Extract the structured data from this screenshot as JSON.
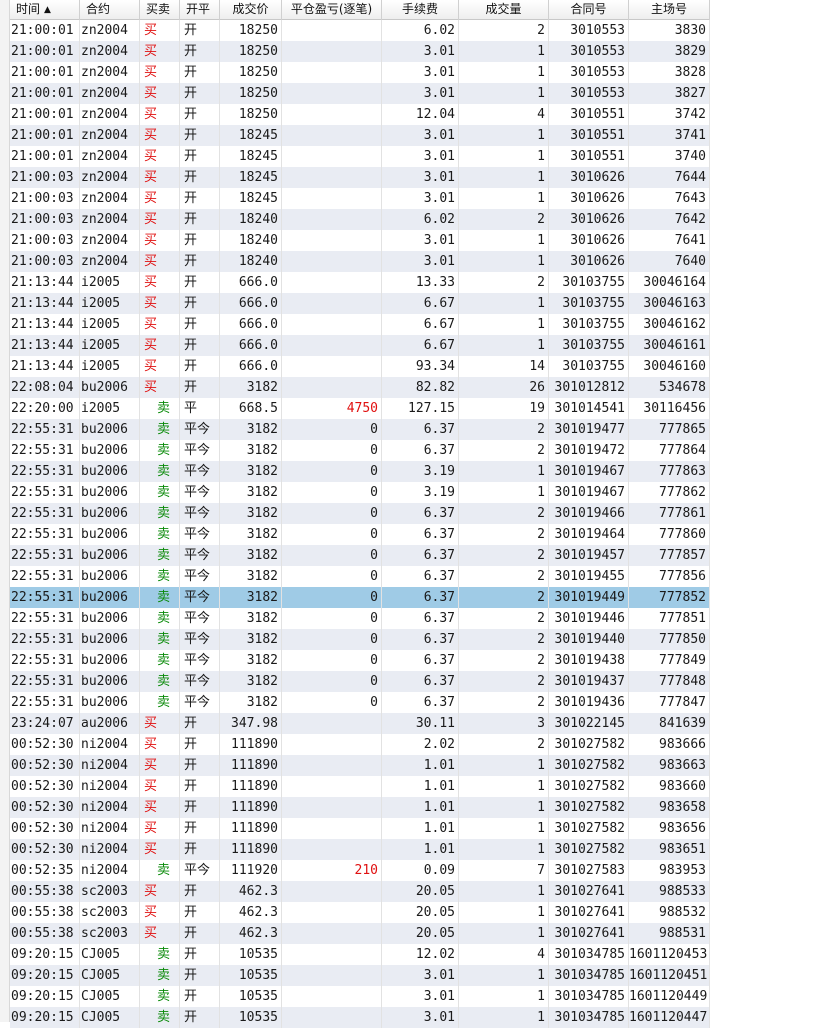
{
  "columns": {
    "time": "时间",
    "symbol": "合约",
    "side": "买卖",
    "open_close": "开平",
    "price": "成交价",
    "pnl": "平仓盈亏(逐笔)",
    "fee": "手续费",
    "qty": "成交量",
    "contract_no": "合同号",
    "match_no": "主场号"
  },
  "sort": {
    "column": "time",
    "direction": "ascending",
    "icon": "sort-ascending-icon"
  },
  "colors": {
    "buy": "#e01010",
    "sell": "#0a8a0a",
    "selected_row": "#9fcbe6",
    "alt_row": "#e9ecf3"
  },
  "rows": [
    {
      "time": "21:00:01",
      "symbol": "zn2004",
      "side": "买",
      "open_close": "开",
      "price": "18250",
      "pnl": "",
      "fee": "6.02",
      "qty": "2",
      "contract_no": "3010553",
      "match_no": "3830"
    },
    {
      "time": "21:00:01",
      "symbol": "zn2004",
      "side": "买",
      "open_close": "开",
      "price": "18250",
      "pnl": "",
      "fee": "3.01",
      "qty": "1",
      "contract_no": "3010553",
      "match_no": "3829"
    },
    {
      "time": "21:00:01",
      "symbol": "zn2004",
      "side": "买",
      "open_close": "开",
      "price": "18250",
      "pnl": "",
      "fee": "3.01",
      "qty": "1",
      "contract_no": "3010553",
      "match_no": "3828"
    },
    {
      "time": "21:00:01",
      "symbol": "zn2004",
      "side": "买",
      "open_close": "开",
      "price": "18250",
      "pnl": "",
      "fee": "3.01",
      "qty": "1",
      "contract_no": "3010553",
      "match_no": "3827"
    },
    {
      "time": "21:00:01",
      "symbol": "zn2004",
      "side": "买",
      "open_close": "开",
      "price": "18250",
      "pnl": "",
      "fee": "12.04",
      "qty": "4",
      "contract_no": "3010551",
      "match_no": "3742"
    },
    {
      "time": "21:00:01",
      "symbol": "zn2004",
      "side": "买",
      "open_close": "开",
      "price": "18245",
      "pnl": "",
      "fee": "3.01",
      "qty": "1",
      "contract_no": "3010551",
      "match_no": "3741"
    },
    {
      "time": "21:00:01",
      "symbol": "zn2004",
      "side": "买",
      "open_close": "开",
      "price": "18245",
      "pnl": "",
      "fee": "3.01",
      "qty": "1",
      "contract_no": "3010551",
      "match_no": "3740"
    },
    {
      "time": "21:00:03",
      "symbol": "zn2004",
      "side": "买",
      "open_close": "开",
      "price": "18245",
      "pnl": "",
      "fee": "3.01",
      "qty": "1",
      "contract_no": "3010626",
      "match_no": "7644"
    },
    {
      "time": "21:00:03",
      "symbol": "zn2004",
      "side": "买",
      "open_close": "开",
      "price": "18245",
      "pnl": "",
      "fee": "3.01",
      "qty": "1",
      "contract_no": "3010626",
      "match_no": "7643"
    },
    {
      "time": "21:00:03",
      "symbol": "zn2004",
      "side": "买",
      "open_close": "开",
      "price": "18240",
      "pnl": "",
      "fee": "6.02",
      "qty": "2",
      "contract_no": "3010626",
      "match_no": "7642"
    },
    {
      "time": "21:00:03",
      "symbol": "zn2004",
      "side": "买",
      "open_close": "开",
      "price": "18240",
      "pnl": "",
      "fee": "3.01",
      "qty": "1",
      "contract_no": "3010626",
      "match_no": "7641"
    },
    {
      "time": "21:00:03",
      "symbol": "zn2004",
      "side": "买",
      "open_close": "开",
      "price": "18240",
      "pnl": "",
      "fee": "3.01",
      "qty": "1",
      "contract_no": "3010626",
      "match_no": "7640"
    },
    {
      "time": "21:13:44",
      "symbol": "i2005",
      "side": "买",
      "open_close": "开",
      "price": "666.0",
      "pnl": "",
      "fee": "13.33",
      "qty": "2",
      "contract_no": "30103755",
      "match_no": "30046164"
    },
    {
      "time": "21:13:44",
      "symbol": "i2005",
      "side": "买",
      "open_close": "开",
      "price": "666.0",
      "pnl": "",
      "fee": "6.67",
      "qty": "1",
      "contract_no": "30103755",
      "match_no": "30046163"
    },
    {
      "time": "21:13:44",
      "symbol": "i2005",
      "side": "买",
      "open_close": "开",
      "price": "666.0",
      "pnl": "",
      "fee": "6.67",
      "qty": "1",
      "contract_no": "30103755",
      "match_no": "30046162"
    },
    {
      "time": "21:13:44",
      "symbol": "i2005",
      "side": "买",
      "open_close": "开",
      "price": "666.0",
      "pnl": "",
      "fee": "6.67",
      "qty": "1",
      "contract_no": "30103755",
      "match_no": "30046161"
    },
    {
      "time": "21:13:44",
      "symbol": "i2005",
      "side": "买",
      "open_close": "开",
      "price": "666.0",
      "pnl": "",
      "fee": "93.34",
      "qty": "14",
      "contract_no": "30103755",
      "match_no": "30046160"
    },
    {
      "time": "22:08:04",
      "symbol": "bu2006",
      "side": "买",
      "open_close": "开",
      "price": "3182",
      "pnl": "",
      "fee": "82.82",
      "qty": "26",
      "contract_no": "301012812",
      "match_no": "534678"
    },
    {
      "time": "22:20:00",
      "symbol": "i2005",
      "side": "卖",
      "open_close": "平",
      "price": "668.5",
      "pnl": "4750",
      "fee": "127.15",
      "qty": "19",
      "contract_no": "301014541",
      "match_no": "30116456"
    },
    {
      "time": "22:55:31",
      "symbol": "bu2006",
      "side": "卖",
      "open_close": "平今",
      "price": "3182",
      "pnl": "0",
      "fee": "6.37",
      "qty": "2",
      "contract_no": "301019477",
      "match_no": "777865"
    },
    {
      "time": "22:55:31",
      "symbol": "bu2006",
      "side": "卖",
      "open_close": "平今",
      "price": "3182",
      "pnl": "0",
      "fee": "6.37",
      "qty": "2",
      "contract_no": "301019472",
      "match_no": "777864"
    },
    {
      "time": "22:55:31",
      "symbol": "bu2006",
      "side": "卖",
      "open_close": "平今",
      "price": "3182",
      "pnl": "0",
      "fee": "3.19",
      "qty": "1",
      "contract_no": "301019467",
      "match_no": "777863"
    },
    {
      "time": "22:55:31",
      "symbol": "bu2006",
      "side": "卖",
      "open_close": "平今",
      "price": "3182",
      "pnl": "0",
      "fee": "3.19",
      "qty": "1",
      "contract_no": "301019467",
      "match_no": "777862"
    },
    {
      "time": "22:55:31",
      "symbol": "bu2006",
      "side": "卖",
      "open_close": "平今",
      "price": "3182",
      "pnl": "0",
      "fee": "6.37",
      "qty": "2",
      "contract_no": "301019466",
      "match_no": "777861"
    },
    {
      "time": "22:55:31",
      "symbol": "bu2006",
      "side": "卖",
      "open_close": "平今",
      "price": "3182",
      "pnl": "0",
      "fee": "6.37",
      "qty": "2",
      "contract_no": "301019464",
      "match_no": "777860"
    },
    {
      "time": "22:55:31",
      "symbol": "bu2006",
      "side": "卖",
      "open_close": "平今",
      "price": "3182",
      "pnl": "0",
      "fee": "6.37",
      "qty": "2",
      "contract_no": "301019457",
      "match_no": "777857"
    },
    {
      "time": "22:55:31",
      "symbol": "bu2006",
      "side": "卖",
      "open_close": "平今",
      "price": "3182",
      "pnl": "0",
      "fee": "6.37",
      "qty": "2",
      "contract_no": "301019455",
      "match_no": "777856"
    },
    {
      "time": "22:55:31",
      "symbol": "bu2006",
      "side": "卖",
      "open_close": "平今",
      "price": "3182",
      "pnl": "0",
      "fee": "6.37",
      "qty": "2",
      "contract_no": "301019449",
      "match_no": "777852",
      "selected": true
    },
    {
      "time": "22:55:31",
      "symbol": "bu2006",
      "side": "卖",
      "open_close": "平今",
      "price": "3182",
      "pnl": "0",
      "fee": "6.37",
      "qty": "2",
      "contract_no": "301019446",
      "match_no": "777851"
    },
    {
      "time": "22:55:31",
      "symbol": "bu2006",
      "side": "卖",
      "open_close": "平今",
      "price": "3182",
      "pnl": "0",
      "fee": "6.37",
      "qty": "2",
      "contract_no": "301019440",
      "match_no": "777850"
    },
    {
      "time": "22:55:31",
      "symbol": "bu2006",
      "side": "卖",
      "open_close": "平今",
      "price": "3182",
      "pnl": "0",
      "fee": "6.37",
      "qty": "2",
      "contract_no": "301019438",
      "match_no": "777849"
    },
    {
      "time": "22:55:31",
      "symbol": "bu2006",
      "side": "卖",
      "open_close": "平今",
      "price": "3182",
      "pnl": "0",
      "fee": "6.37",
      "qty": "2",
      "contract_no": "301019437",
      "match_no": "777848"
    },
    {
      "time": "22:55:31",
      "symbol": "bu2006",
      "side": "卖",
      "open_close": "平今",
      "price": "3182",
      "pnl": "0",
      "fee": "6.37",
      "qty": "2",
      "contract_no": "301019436",
      "match_no": "777847"
    },
    {
      "time": "23:24:07",
      "symbol": "au2006",
      "side": "买",
      "open_close": "开",
      "price": "347.98",
      "pnl": "",
      "fee": "30.11",
      "qty": "3",
      "contract_no": "301022145",
      "match_no": "841639"
    },
    {
      "time": "00:52:30",
      "symbol": "ni2004",
      "side": "买",
      "open_close": "开",
      "price": "111890",
      "pnl": "",
      "fee": "2.02",
      "qty": "2",
      "contract_no": "301027582",
      "match_no": "983666"
    },
    {
      "time": "00:52:30",
      "symbol": "ni2004",
      "side": "买",
      "open_close": "开",
      "price": "111890",
      "pnl": "",
      "fee": "1.01",
      "qty": "1",
      "contract_no": "301027582",
      "match_no": "983663"
    },
    {
      "time": "00:52:30",
      "symbol": "ni2004",
      "side": "买",
      "open_close": "开",
      "price": "111890",
      "pnl": "",
      "fee": "1.01",
      "qty": "1",
      "contract_no": "301027582",
      "match_no": "983660"
    },
    {
      "time": "00:52:30",
      "symbol": "ni2004",
      "side": "买",
      "open_close": "开",
      "price": "111890",
      "pnl": "",
      "fee": "1.01",
      "qty": "1",
      "contract_no": "301027582",
      "match_no": "983658"
    },
    {
      "time": "00:52:30",
      "symbol": "ni2004",
      "side": "买",
      "open_close": "开",
      "price": "111890",
      "pnl": "",
      "fee": "1.01",
      "qty": "1",
      "contract_no": "301027582",
      "match_no": "983656"
    },
    {
      "time": "00:52:30",
      "symbol": "ni2004",
      "side": "买",
      "open_close": "开",
      "price": "111890",
      "pnl": "",
      "fee": "1.01",
      "qty": "1",
      "contract_no": "301027582",
      "match_no": "983651"
    },
    {
      "time": "00:52:35",
      "symbol": "ni2004",
      "side": "卖",
      "open_close": "平今",
      "price": "111920",
      "pnl": "210",
      "fee": "0.09",
      "qty": "7",
      "contract_no": "301027583",
      "match_no": "983953"
    },
    {
      "time": "00:55:38",
      "symbol": "sc2003",
      "side": "买",
      "open_close": "开",
      "price": "462.3",
      "pnl": "",
      "fee": "20.05",
      "qty": "1",
      "contract_no": "301027641",
      "match_no": "988533"
    },
    {
      "time": "00:55:38",
      "symbol": "sc2003",
      "side": "买",
      "open_close": "开",
      "price": "462.3",
      "pnl": "",
      "fee": "20.05",
      "qty": "1",
      "contract_no": "301027641",
      "match_no": "988532"
    },
    {
      "time": "00:55:38",
      "symbol": "sc2003",
      "side": "买",
      "open_close": "开",
      "price": "462.3",
      "pnl": "",
      "fee": "20.05",
      "qty": "1",
      "contract_no": "301027641",
      "match_no": "988531"
    },
    {
      "time": "09:20:15",
      "symbol": "CJ005",
      "side": "卖",
      "open_close": "开",
      "price": "10535",
      "pnl": "",
      "fee": "12.02",
      "qty": "4",
      "contract_no": "301034785",
      "match_no": "1601120453"
    },
    {
      "time": "09:20:15",
      "symbol": "CJ005",
      "side": "卖",
      "open_close": "开",
      "price": "10535",
      "pnl": "",
      "fee": "3.01",
      "qty": "1",
      "contract_no": "301034785",
      "match_no": "1601120451"
    },
    {
      "time": "09:20:15",
      "symbol": "CJ005",
      "side": "卖",
      "open_close": "开",
      "price": "10535",
      "pnl": "",
      "fee": "3.01",
      "qty": "1",
      "contract_no": "301034785",
      "match_no": "1601120449"
    },
    {
      "time": "09:20:15",
      "symbol": "CJ005",
      "side": "卖",
      "open_close": "开",
      "price": "10535",
      "pnl": "",
      "fee": "3.01",
      "qty": "1",
      "contract_no": "301034785",
      "match_no": "1601120447"
    }
  ]
}
